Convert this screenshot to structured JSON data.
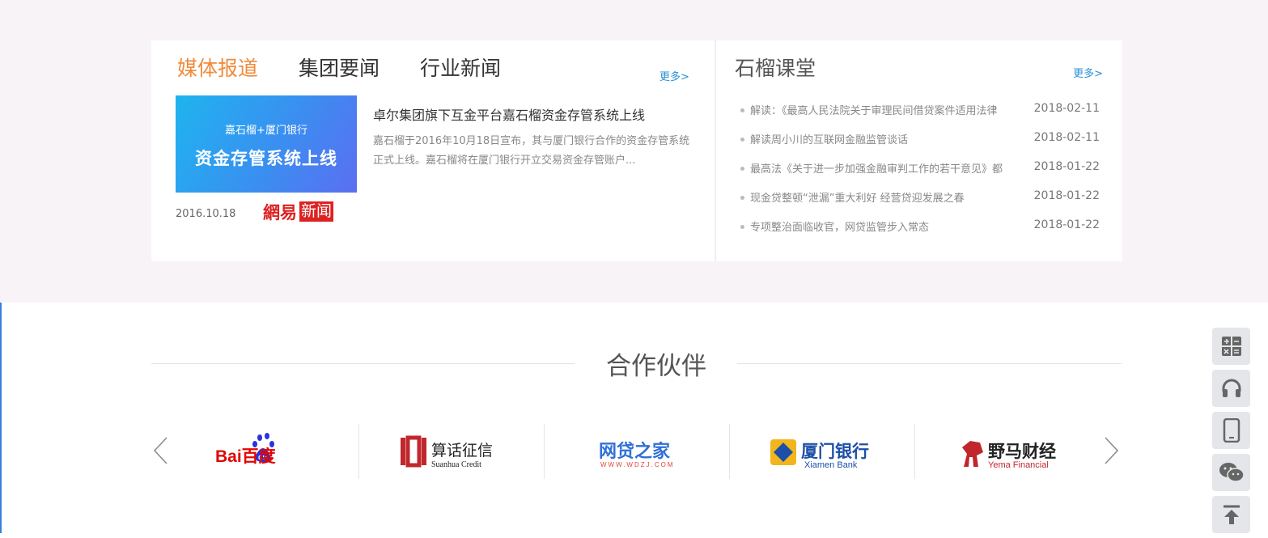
{
  "news": {
    "tabs": [
      "媒体报道",
      "集团要闻",
      "行业新闻"
    ],
    "more_label": "更多>",
    "banner": {
      "line1": "嘉石榴+厦门银行",
      "line2": "资金存管系统上线"
    },
    "date": "2016.10.18",
    "source": {
      "part1": "網易",
      "part2": "新闻"
    },
    "title": "卓尔集团旗下互金平台嘉石榴资金存管系统上线",
    "summary": "嘉石榴于2016年10月18日宣布，其与厦门银行合作的资金存管系统正式上线。嘉石榴将在厦门银行开立交易资金存管账户..."
  },
  "classroom": {
    "title": "石榴课堂",
    "more_label": "更多>",
    "items": [
      {
        "text": "解读：《最高人民法院关于审理民间借贷案件适用法律",
        "date": "2018-02-11"
      },
      {
        "text": "解读周小川的互联网金融监管谈话",
        "date": "2018-02-11"
      },
      {
        "text": "最高法《关于进一步加强金融审判工作的若干意见》都",
        "date": "2018-01-22"
      },
      {
        "text": "现金贷整顿“泄漏”重大利好 经营贷迎发展之春",
        "date": "2018-01-22"
      },
      {
        "text": "专项整治面临收官，网贷监管步入常态",
        "date": "2018-01-22"
      }
    ]
  },
  "partners": {
    "title": "合作伙伴",
    "logos": [
      {
        "main": "Bai百度",
        "sub": "du"
      },
      {
        "main": "算话征信",
        "sub": "Suanhua Credit"
      },
      {
        "main": "网贷之家",
        "sub": "WWW.WDZJ.COM"
      },
      {
        "main": "厦门银行",
        "sub": "Xiamen Bank"
      },
      {
        "main": "野马财经",
        "sub": "Yema Financial"
      }
    ]
  },
  "side_tools": [
    "calculator-icon",
    "headset-icon",
    "mobile-icon",
    "wechat-icon",
    "back-to-top-icon"
  ],
  "colors": {
    "accent": "#f08a3c",
    "link": "#2a8fd6",
    "brand_red": "#d22222"
  }
}
